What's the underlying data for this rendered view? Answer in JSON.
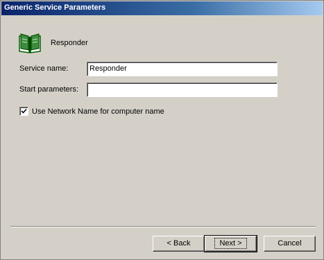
{
  "window": {
    "title": "Generic Service Parameters"
  },
  "header": {
    "label": "Responder",
    "icon": "book-icon"
  },
  "form": {
    "service_name_label": "Service name:",
    "service_name_value": "Responder",
    "start_params_label": "Start parameters:",
    "start_params_value": "",
    "use_network_name_label": "Use Network Name for computer name",
    "use_network_name_checked": true
  },
  "buttons": {
    "back": "< Back",
    "next": "Next >",
    "cancel": "Cancel"
  },
  "colors": {
    "titlebar_start": "#0a246a",
    "titlebar_end": "#a6caf0",
    "face": "#d4d0c8"
  }
}
